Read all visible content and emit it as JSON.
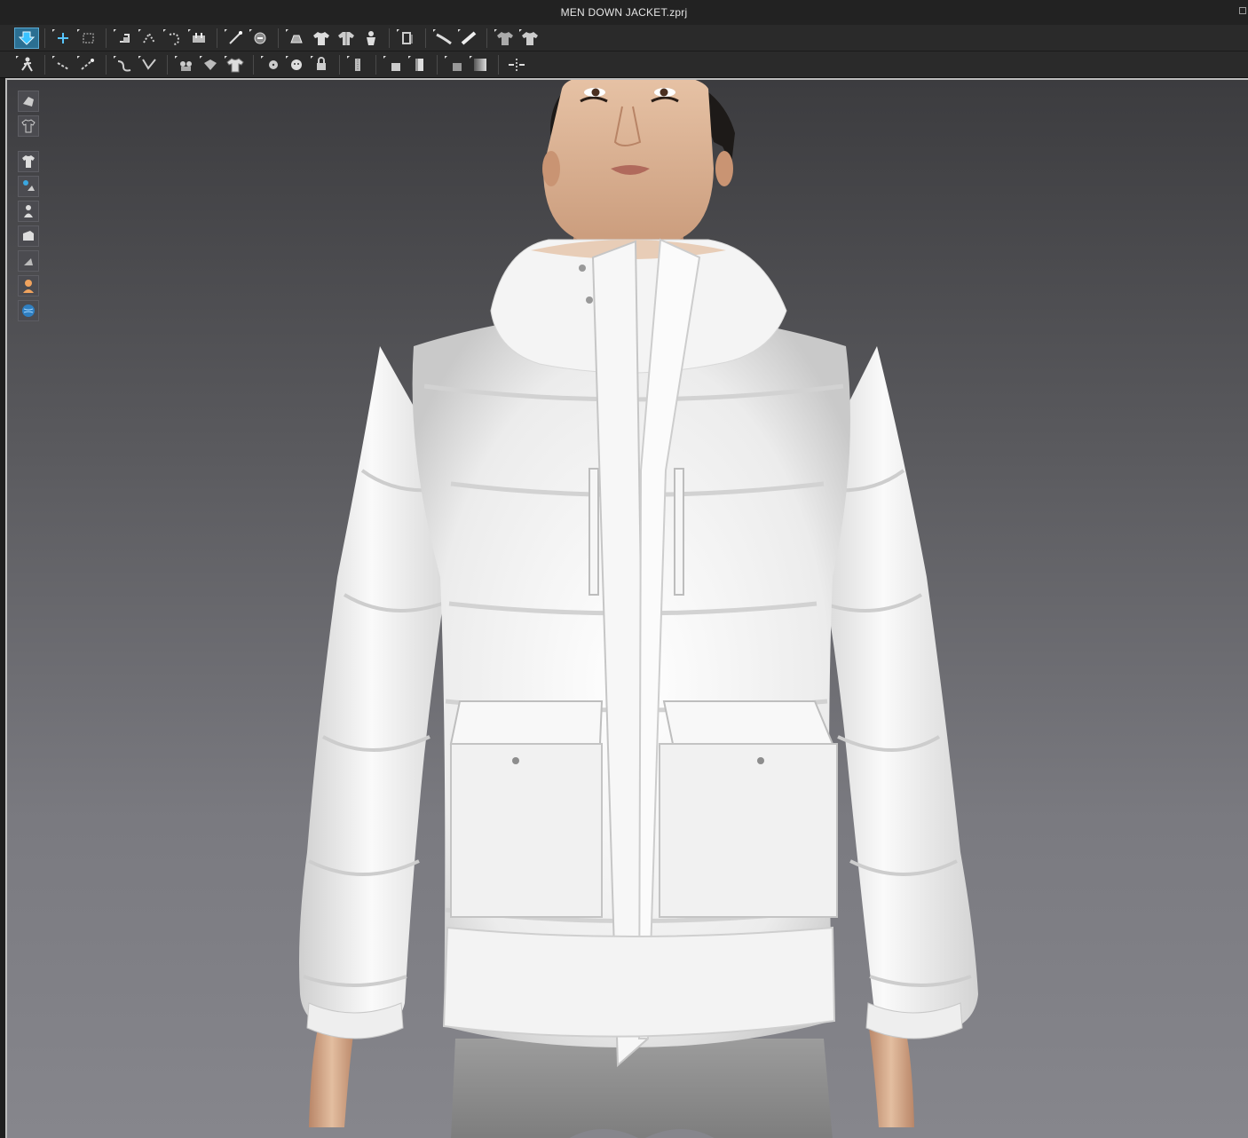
{
  "window": {
    "title": "MEN DOWN JACKET.zprj"
  },
  "toolbar_row1": [
    {
      "icon": "simulation-icon",
      "active": true
    },
    {
      "icon": "select-move-icon"
    },
    {
      "icon": "select-mesh-box-icon"
    },
    {
      "icon": "fold-arrangement-icon"
    },
    {
      "icon": "fold-icon"
    },
    {
      "icon": "rotate-fold-icon"
    },
    {
      "icon": "tack-icon"
    },
    {
      "icon": "pen-line-icon"
    },
    {
      "icon": "pin-icon"
    },
    {
      "icon": "brush-icon"
    },
    {
      "icon": "garment-front-icon"
    },
    {
      "icon": "garment-back-icon"
    },
    {
      "icon": "avatar-icon"
    },
    {
      "icon": "texture-edit-icon"
    },
    {
      "icon": "tape-measure-icon"
    },
    {
      "icon": "ruler-icon"
    },
    {
      "icon": "fit-map-icon"
    },
    {
      "icon": "shirt-snapshot-icon"
    }
  ],
  "toolbar_row2": [
    {
      "icon": "avatar-pose-icon"
    },
    {
      "icon": "select-line-icon"
    },
    {
      "icon": "edit-curve-icon"
    },
    {
      "icon": "sewing-line-icon"
    },
    {
      "icon": "segment-sewing-icon"
    },
    {
      "icon": "arrangement-point-icon"
    },
    {
      "icon": "graphic-icon"
    },
    {
      "icon": "shirt-texture-icon"
    },
    {
      "icon": "button-icon"
    },
    {
      "icon": "button-hole-icon"
    },
    {
      "icon": "buttonhole-lock-icon"
    },
    {
      "icon": "zipper-icon"
    },
    {
      "icon": "topstitch-icon"
    },
    {
      "icon": "fabric-roll-icon"
    },
    {
      "icon": "puckering-icon"
    },
    {
      "icon": "gradient-icon"
    },
    {
      "icon": "piping-icon"
    }
  ],
  "side_tools": [
    {
      "icon": "3d-pattern-icon"
    },
    {
      "icon": "shirt-wireframe-icon"
    },
    {
      "icon": "show-garment-icon"
    },
    {
      "icon": "show-avatar-arrangement-icon"
    },
    {
      "icon": "show-avatar-icon"
    },
    {
      "icon": "texture-view-icon"
    },
    {
      "icon": "shading-icon"
    },
    {
      "icon": "avatar-skin-icon"
    },
    {
      "icon": "environment-globe-icon"
    }
  ]
}
